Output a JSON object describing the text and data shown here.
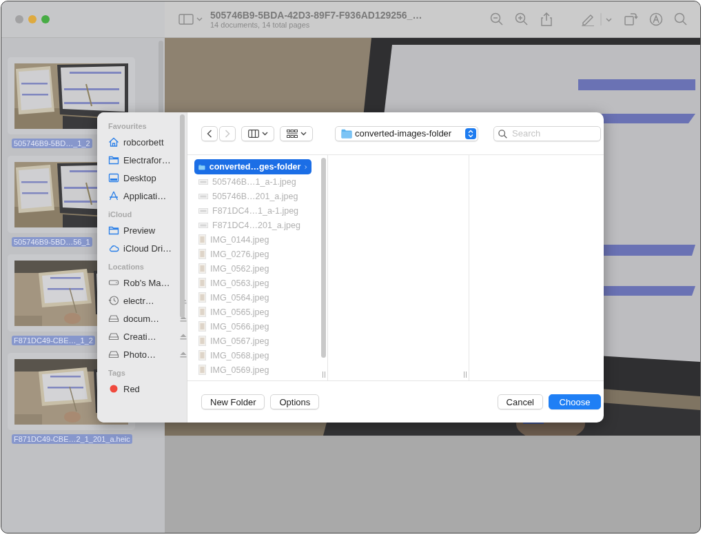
{
  "window": {
    "title": "505746B9-5BDA-42D3-89F7-F936AD129256_…",
    "subtitle": "14 documents, 14 total pages"
  },
  "thumbnails": [
    {
      "label": "505746B9-5BD…_1_2",
      "selected": true
    },
    {
      "label": "505746B9-5BD…56_1",
      "selected": true
    },
    {
      "label": "F871DC49-CBE…_1_2",
      "selected": true
    },
    {
      "label": "F871DC49-CBE…2_1_201_a.heic",
      "selected": true
    }
  ],
  "dialog": {
    "sidebar": [
      {
        "heading": "Favourites",
        "items": [
          {
            "label": "robcorbett",
            "kind": "home"
          },
          {
            "label": "Electrafor…",
            "kind": "folder"
          },
          {
            "label": "Desktop",
            "kind": "desktop"
          },
          {
            "label": "Applicati…",
            "kind": "apps"
          }
        ]
      },
      {
        "heading": "iCloud",
        "items": [
          {
            "label": "Preview",
            "kind": "folder"
          },
          {
            "label": "iCloud Dri…",
            "kind": "cloud"
          }
        ]
      },
      {
        "heading": "Locations",
        "items": [
          {
            "label": "Rob's Ma…",
            "kind": "computer",
            "eject": false
          },
          {
            "label": "electr…",
            "kind": "backup",
            "eject": true
          },
          {
            "label": "docum…",
            "kind": "disk",
            "eject": true
          },
          {
            "label": "Creati…",
            "kind": "disk",
            "eject": true
          },
          {
            "label": "Photo…",
            "kind": "disk",
            "eject": true
          }
        ]
      },
      {
        "heading": "Tags",
        "items": [
          {
            "label": "Red",
            "kind": "tag",
            "color": "#f04a3e"
          }
        ]
      }
    ],
    "toolbar": {
      "back_disabled": false,
      "forward_disabled": true,
      "path": "converted-images-folder",
      "search_placeholder": "Search"
    },
    "files": [
      {
        "name": "converted…ges-folder",
        "kind": "folder",
        "selected": true,
        "disabled": false
      },
      {
        "name": "505746B…1_a-1.jpeg",
        "kind": "wide",
        "selected": false,
        "disabled": true
      },
      {
        "name": "505746B…201_a.jpeg",
        "kind": "wide",
        "selected": false,
        "disabled": true
      },
      {
        "name": "F871DC4…1_a-1.jpeg",
        "kind": "wide",
        "selected": false,
        "disabled": true
      },
      {
        "name": "F871DC4…201_a.jpeg",
        "kind": "wide",
        "selected": false,
        "disabled": true
      },
      {
        "name": "IMG_0144.jpeg",
        "kind": "tall",
        "selected": false,
        "disabled": true
      },
      {
        "name": "IMG_0276.jpeg",
        "kind": "tall",
        "selected": false,
        "disabled": true
      },
      {
        "name": "IMG_0562.jpeg",
        "kind": "tall",
        "selected": false,
        "disabled": true
      },
      {
        "name": "IMG_0563.jpeg",
        "kind": "tall",
        "selected": false,
        "disabled": true
      },
      {
        "name": "IMG_0564.jpeg",
        "kind": "tall",
        "selected": false,
        "disabled": true
      },
      {
        "name": "IMG_0565.jpeg",
        "kind": "tall",
        "selected": false,
        "disabled": true
      },
      {
        "name": "IMG_0566.jpeg",
        "kind": "tall",
        "selected": false,
        "disabled": true
      },
      {
        "name": "IMG_0567.jpeg",
        "kind": "tall",
        "selected": false,
        "disabled": true
      },
      {
        "name": "IMG_0568.jpeg",
        "kind": "tall",
        "selected": false,
        "disabled": true
      },
      {
        "name": "IMG_0569.jpeg",
        "kind": "tall",
        "selected": false,
        "disabled": true
      }
    ],
    "buttons_left": [
      {
        "label": "New Folder",
        "kind": "plain"
      },
      {
        "label": "Options",
        "kind": "plain"
      }
    ],
    "buttons_right": [
      {
        "label": "Cancel",
        "kind": "plain"
      },
      {
        "label": "Choose",
        "kind": "primary"
      }
    ]
  }
}
